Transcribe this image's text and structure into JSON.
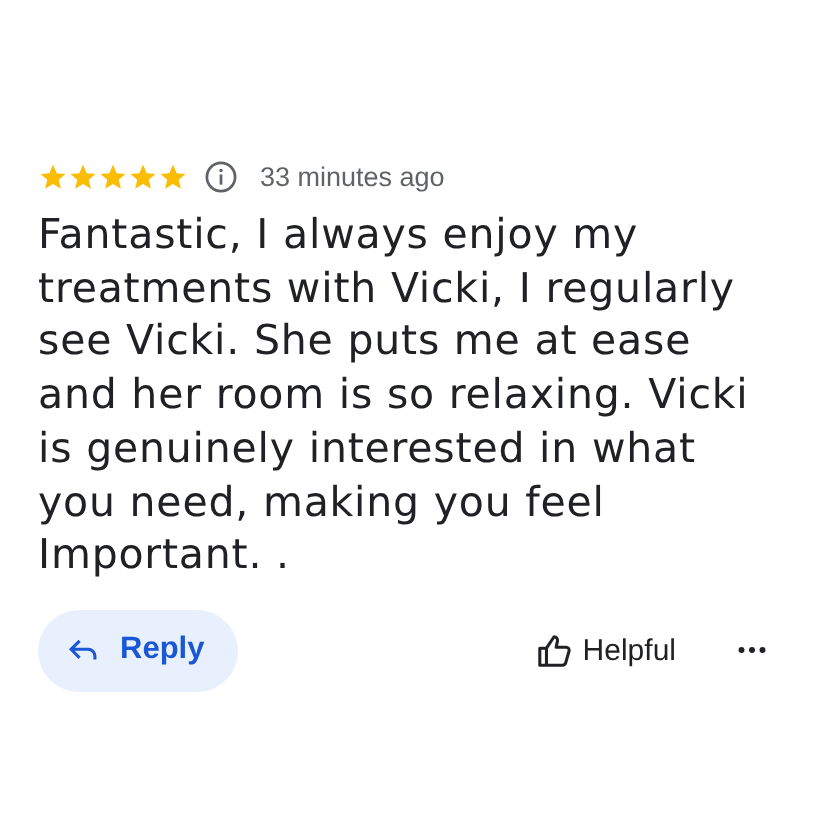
{
  "review": {
    "stars": 5,
    "time": "33 minutes ago",
    "text": "Fantastic, I always enjoy my treatments with Vicki, I regularly see Vicki. She puts me at ease and her room is so relaxing. Vicki is genuinely interested in what you need, making you feel Important. ."
  },
  "actions": {
    "reply": "Reply",
    "helpful": "Helpful"
  }
}
